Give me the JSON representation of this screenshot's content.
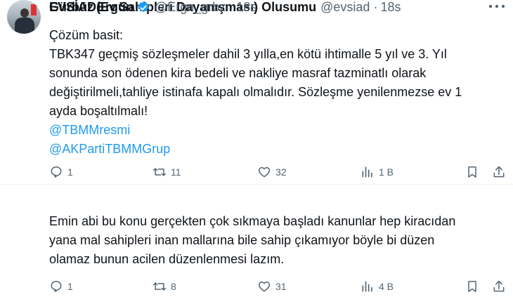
{
  "tweets": [
    {
      "author_name": "EVSİAD(Ev Sahipleri Dayanışması) Olusumu",
      "handle": "@evsiad",
      "separator": "·",
      "time": "18s",
      "lines": [
        "Çözüm basit:",
        "TBK347 geçmiş sözleşmeler dahil 3 yılla,en kötü ihtimalle 5 yıl ve 3. Yıl",
        "sonunda son ödenen kira bedeli ve nakliye masraf tazminatlı  olarak",
        "değiştirilmeli,tahliye istinafa kapalı olmalıdır. Sözleşme yenilenmezse ev 1",
        "ayda boşaltılmalı!"
      ],
      "mentions": [
        "@TBMMresmi",
        "@AKPartiTBMMGrup"
      ],
      "replies": "1",
      "reposts": "11",
      "likes": "32",
      "views": "1 B"
    },
    {
      "author_name": "Gürbüz Ergün",
      "verified": true,
      "handle": "@Ergn_grbz",
      "separator": "·",
      "time": "18s",
      "lines": [
        "Emin abi bu konu gerçekten çok sıkmaya başladı kanunlar hep kiracıdan",
        "yana mal sahipleri inan mallarına bile sahip çıkamıyor böyle bi düzen",
        "olamaz bunun acilen düzenlenmesi lazım."
      ],
      "replies": "1",
      "reposts": "8",
      "likes": "31",
      "views": "4 B"
    }
  ],
  "icons": {
    "reply": "reply-icon",
    "repost": "repost-icon",
    "like": "heart-icon",
    "views": "views-icon",
    "bookmark": "bookmark-icon",
    "share": "share-icon",
    "more": "more-icon",
    "verified": "verified-badge-icon"
  },
  "colors": {
    "link": "#1d9bf0",
    "secondary_text": "#536471",
    "verified": "#1d9bf0"
  }
}
